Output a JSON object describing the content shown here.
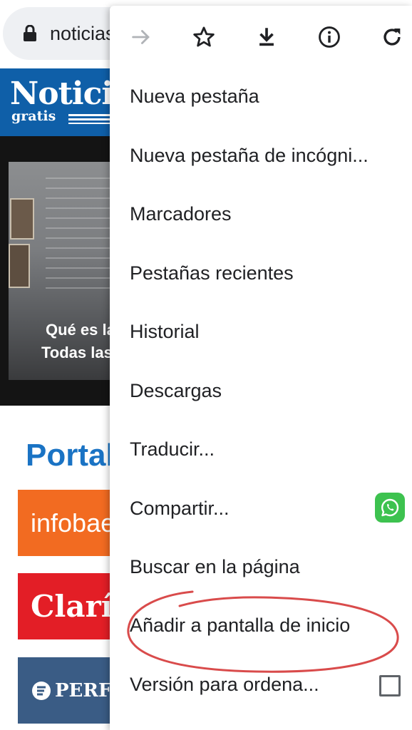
{
  "omnibox": {
    "url_text": "noticias",
    "lock_icon": "lock-icon"
  },
  "site": {
    "logo_main": "Noticias",
    "logo_sub": "gratis",
    "hero": {
      "title_line1": "Qué es la",
      "title_line2": "Todas las"
    },
    "section_title": "Portales",
    "tiles": [
      {
        "label": "infobae",
        "color": "#f26b21"
      },
      {
        "label": "Clarín",
        "color": "#e31e26"
      },
      {
        "label": "PERFIL",
        "color": "#3a5c85"
      }
    ],
    "brand_color": "#0f5fa8"
  },
  "menu": {
    "toolbar_icons": [
      "forward-icon",
      "star-icon",
      "download-icon",
      "info-icon",
      "reload-icon"
    ],
    "items": [
      {
        "label": "Nueva pestaña"
      },
      {
        "label": "Nueva pestaña de incógni..."
      },
      {
        "label": "Marcadores"
      },
      {
        "label": "Pestañas recientes"
      },
      {
        "label": "Historial"
      },
      {
        "label": "Descargas"
      },
      {
        "label": "Traducir..."
      },
      {
        "label": "Compartir...",
        "trailing_icon": "whatsapp-icon"
      },
      {
        "label": "Buscar en la página"
      },
      {
        "label": "Añadir a pantalla de inicio",
        "highlighted": true,
        "highlight_color": "#d94b4b"
      },
      {
        "label": "Versión para ordena...",
        "checkbox_checked": false
      }
    ]
  }
}
